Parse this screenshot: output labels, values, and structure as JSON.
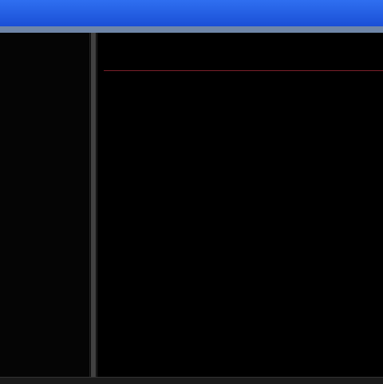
{
  "window": {
    "title": ""
  },
  "left_pane": {
    "lines": [
      "",
      "",
      "",
      "",
      "",
      ""
    ]
  },
  "table": {
    "rows": [
      {
        "c1": "",
        "c2": "",
        "c3": "",
        "c4": "",
        "c5": ""
      },
      {
        "c1": "",
        "c2": "",
        "c3": "",
        "c4": "",
        "c5": ""
      },
      {
        "c1": "",
        "c2": "",
        "c3": "",
        "c4": "",
        "c5": ""
      },
      {
        "c1": "",
        "c2": "",
        "c3": "",
        "c4": "",
        "c5": ""
      },
      {
        "c1": "",
        "c2": "",
        "c3": "",
        "c4": "",
        "c5": ""
      },
      {
        "c1": "",
        "c2": "",
        "c3": "",
        "c4": "",
        "c5": ""
      },
      {
        "c1": "",
        "c2": "",
        "c3": "",
        "c4": "",
        "c5": ""
      },
      {
        "c1": "",
        "c2": "",
        "c3": "",
        "c4": "",
        "c5": ""
      },
      {
        "c1": "",
        "c2": "",
        "c3": "",
        "c4": "",
        "c5": ""
      },
      {
        "c1": "",
        "c2": "",
        "c3": "",
        "c4": "",
        "c5": ""
      },
      {
        "c1": "",
        "c2": "",
        "c3": "",
        "c4": "",
        "c5": ""
      },
      {
        "c1": "",
        "c2": "",
        "c3": "",
        "c4": "",
        "c5": ""
      },
      {
        "c1": "",
        "c2": "",
        "c3": "",
        "c4": "",
        "c5": ""
      },
      {
        "c1": "",
        "c2": "",
        "c3": "",
        "c4": "",
        "c5": ""
      },
      {
        "c1": "",
        "c2": "",
        "c3": "",
        "c4": "",
        "c5": ""
      },
      {
        "c1": "",
        "c2": "",
        "c3": "",
        "c4": "",
        "c5": ""
      },
      {
        "c1": "",
        "c2": "",
        "c3": "",
        "c4": "",
        "c5": ""
      },
      {
        "c1": "",
        "c2": "",
        "c3": "",
        "c4": "",
        "c5": ""
      },
      {
        "c1": "",
        "c2": "",
        "c3": "",
        "c4": "",
        "c5": ""
      },
      {
        "c1": "",
        "c2": "",
        "c3": "",
        "c4": "",
        "c5": ""
      },
      {
        "c1": "",
        "c2": "",
        "c3": "",
        "c4": "",
        "c5": ""
      },
      {
        "c1": "",
        "c2": "",
        "c3": "",
        "c4": "",
        "c5": ""
      },
      {
        "c1": "",
        "c2": "",
        "c3": "",
        "c4": "",
        "c5": ""
      },
      {
        "c1": "",
        "c2": "",
        "c3": "",
        "c4": "",
        "c5": ""
      },
      {
        "c1": "",
        "c2": "",
        "c3": "",
        "c4": "",
        "c5": ""
      },
      {
        "c1": "",
        "c2": "",
        "c3": "",
        "c4": "",
        "c5": ""
      },
      {
        "c1": "",
        "c2": "",
        "c3": "",
        "c4": "",
        "c5": ""
      },
      {
        "c1": "",
        "c2": "",
        "c3": "",
        "c4": "",
        "c5": ""
      },
      {
        "c1": "",
        "c2": "",
        "c3": "",
        "c4": "",
        "c5": ""
      },
      {
        "c1": "",
        "c2": "",
        "c3": "",
        "c4": "",
        "c5": ""
      },
      {
        "c1": "",
        "c2": "",
        "c3": "",
        "c4": "",
        "c5": ""
      },
      {
        "c1": "",
        "c2": "",
        "c3": "",
        "c4": "",
        "c5": ""
      }
    ],
    "selected_row": 3
  },
  "colors": {
    "titlebar": "#1a4fd6",
    "selection": "#7a1f2a"
  }
}
